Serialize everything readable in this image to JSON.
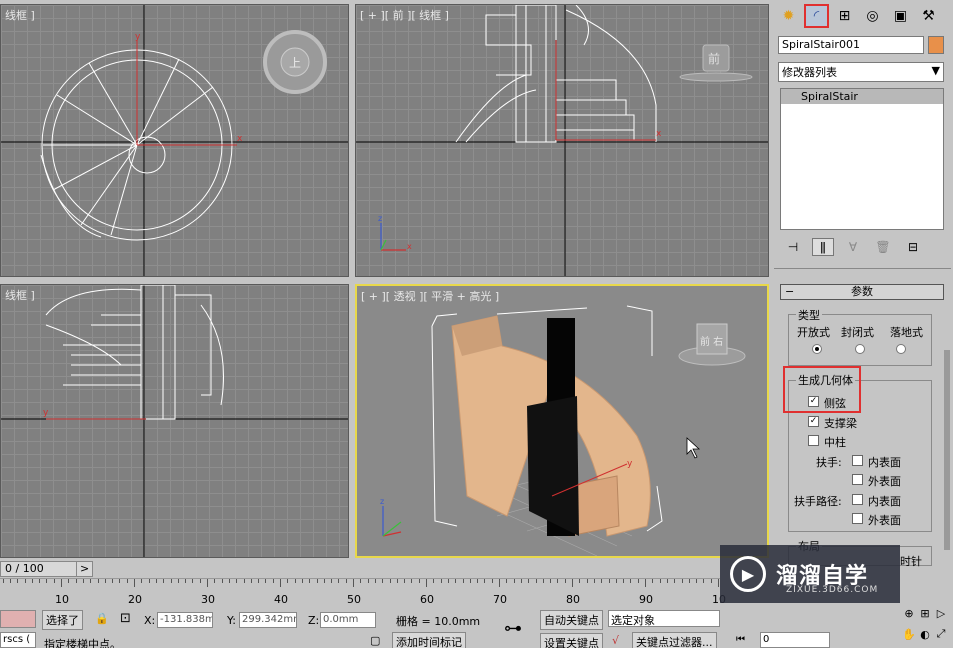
{
  "viewports": {
    "top": {
      "label": "线框 ]",
      "cube_label": "上"
    },
    "front": {
      "label": "[ + ][ 前 ][ 线框 ]",
      "cube_label": "前"
    },
    "left": {
      "label": "线框 ]"
    },
    "perspective": {
      "label": "[ + ][ 透视 ][ 平滑 + 高光 ]",
      "cube_label": "前 右"
    }
  },
  "command_panel": {
    "tabs": [
      "sun-icon",
      "modify-icon",
      "hierarchy-icon",
      "motion-icon",
      "display-icon",
      "utilities-icon"
    ],
    "object_name": "SpiralStair001",
    "object_color": "#e8904a",
    "modifier_list": "修改器列表",
    "stack_items": [
      "SpiralStair"
    ],
    "rollout_title": "参数",
    "type_group": {
      "title": "类型",
      "options": [
        "开放式",
        "封闭式",
        "落地式"
      ],
      "selected": 0
    },
    "generate_group": {
      "title": "生成几何体",
      "stringers": {
        "label": "侧弦",
        "checked": true
      },
      "carriage": {
        "label": "支撑梁",
        "checked": true
      },
      "center_pole": {
        "label": "中柱",
        "checked": false
      },
      "handrail_label": "扶手:",
      "handrail_path_label": "扶手路径:",
      "inside": "内表面",
      "outside": "外表面"
    },
    "layout_title": "布局",
    "clockwise_partial": "时针"
  },
  "timeline": {
    "frame": "0 / 100",
    "ticks": [
      "10",
      "20",
      "30",
      "40",
      "50",
      "60",
      "70",
      "80",
      "90",
      "10"
    ]
  },
  "status": {
    "selected": "选择了",
    "x_label": "X:",
    "x_value": "-131.838m",
    "y_label": "Y:",
    "y_value": "299.342mm",
    "z_label": "Z:",
    "z_value": "0.0mm",
    "grid": "栅格 = 10.0mm",
    "auto_key": "自动关键点",
    "selected_object": "选定对象",
    "set_key": "设置关键点",
    "key_filter": "关键点过滤器...",
    "prompt": "指定楼梯中点。",
    "add_time_tag": "添加时间标记",
    "frame_value": "0",
    "left_box": "rscs ("
  },
  "watermark": {
    "title": "溜溜自学",
    "subtitle": "ZIXUE.3D66.COM"
  }
}
